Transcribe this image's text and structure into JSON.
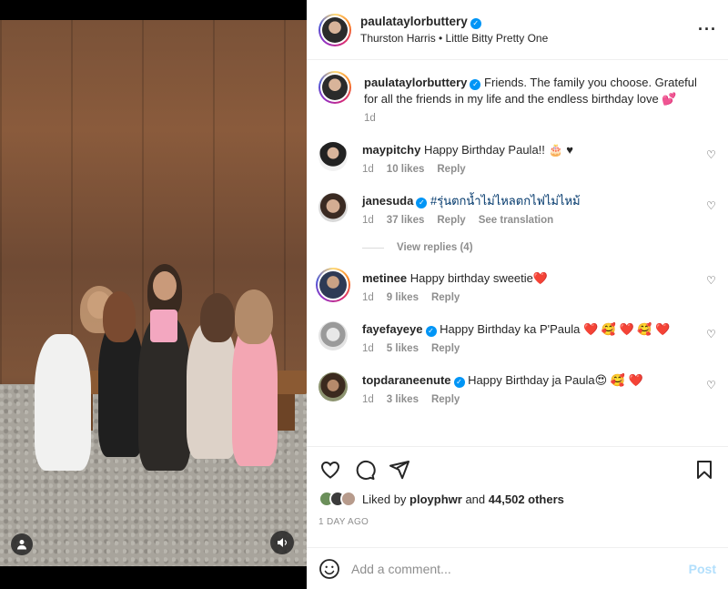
{
  "header": {
    "username": "paulataylorbuttery",
    "audio": "Thurston Harris • Little Bitty Pretty One",
    "more_icon": "more-horizontal-icon"
  },
  "caption": {
    "username": "paulataylorbuttery",
    "text": "Friends. The family you choose. Grateful for all the friends in my life and the endless birthday love 💕",
    "time": "1d"
  },
  "comments": [
    {
      "username": "maypitchy",
      "verified": false,
      "text": "Happy Birthday Paula!! 🎂 ♥",
      "time": "1d",
      "likes": "10 likes",
      "reply": "Reply",
      "translate": ""
    },
    {
      "username": "janesuda",
      "verified": true,
      "text": "#รุ่นตกน้ำไม่ไหลตกไฟไม่ไหม้",
      "time": "1d",
      "likes": "37 likes",
      "reply": "Reply",
      "translate": "See translation"
    },
    {
      "username": "metinee",
      "verified": false,
      "text": "Happy birthday sweetie❤️",
      "time": "1d",
      "likes": "9 likes",
      "reply": "Reply",
      "translate": ""
    },
    {
      "username": "fayefayeye",
      "verified": true,
      "text": "Happy Birthday ka P'Paula ❤️ 🥰 ❤️ 🥰 ❤️",
      "time": "1d",
      "likes": "5 likes",
      "reply": "Reply",
      "translate": ""
    },
    {
      "username": "topdaraneenute",
      "verified": true,
      "text": "Happy Birthday ja Paula😍 🥰 ❤️",
      "time": "1d",
      "likes": "3 likes",
      "reply": "Reply",
      "translate": ""
    }
  ],
  "view_replies": "View replies (4)",
  "actions": {
    "liked_by_prefix": "Liked by",
    "liked_by_user": "ployphwr",
    "liked_by_and": "and",
    "liked_by_count": "44,502 others",
    "time_ago": "1 DAY AGO"
  },
  "add_comment": {
    "placeholder": "Add a comment...",
    "post_label": "Post"
  },
  "colors": {
    "accent": "#0095f6",
    "post_disabled": "#b2dffc",
    "muted": "#8e8e8e",
    "heart": "#ed4956"
  }
}
